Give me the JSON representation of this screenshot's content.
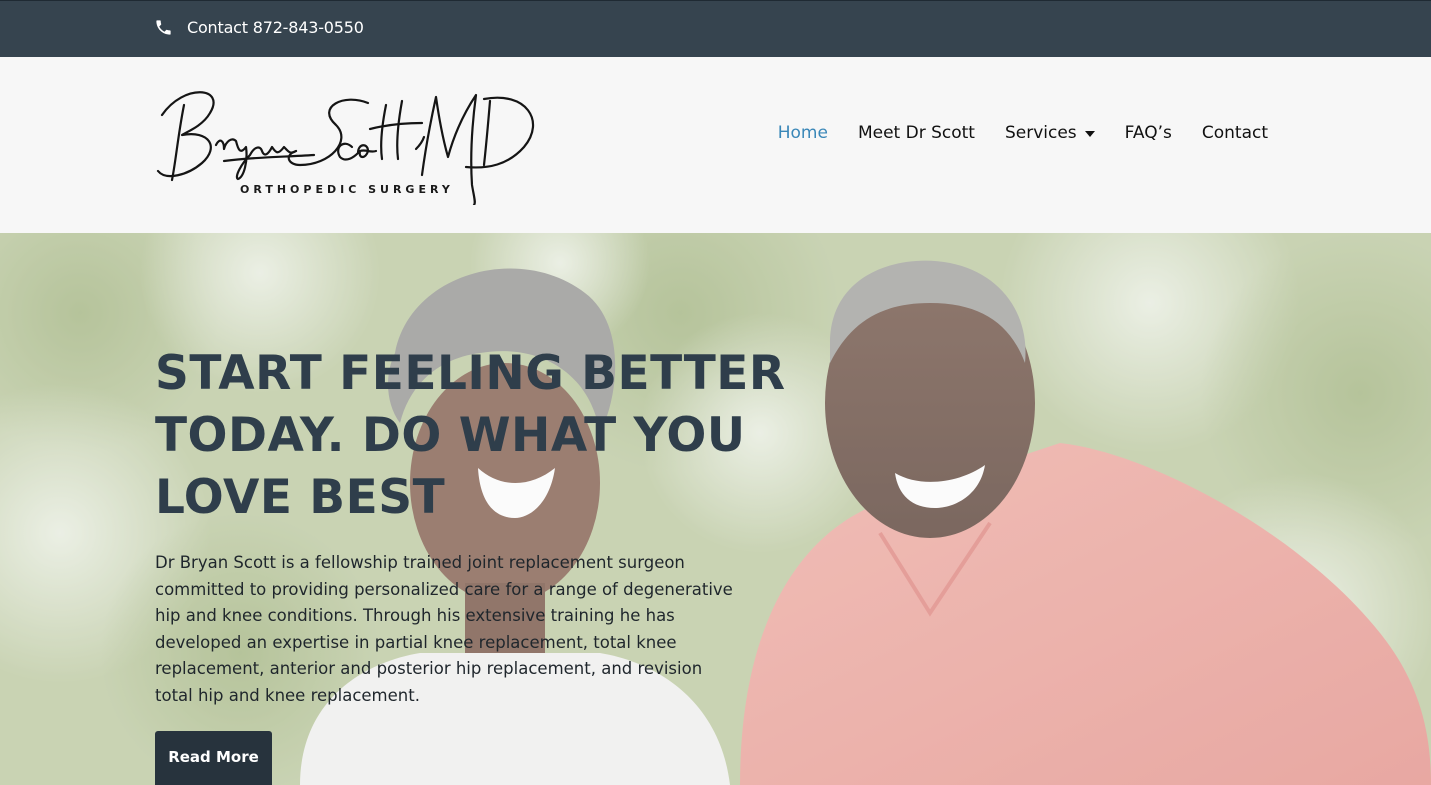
{
  "topbar": {
    "contact_text": "Contact 872-843-0550",
    "icon": "phone-icon",
    "background": "#36444f"
  },
  "header": {
    "logo": {
      "script_text": "Bryan Scott, MD",
      "subtitle": "ORTHOPEDIC SURGERY"
    },
    "nav": [
      {
        "label": "Home",
        "active": true
      },
      {
        "label": "Meet Dr Scott",
        "active": false
      },
      {
        "label": "Services",
        "active": false,
        "has_dropdown": true
      },
      {
        "label": "FAQ’s",
        "active": false
      },
      {
        "label": "Contact",
        "active": false
      }
    ],
    "active_color": "#3a87b8"
  },
  "hero": {
    "title": "START FEELING BETTER TODAY. DO WHAT YOU LOVE BEST",
    "body": "Dr Bryan Scott is a fellowship trained joint replacement surgeon committed to providing personalized care for a range of degenerative hip and knee conditions. Through his extensive training he has developed an expertise in partial knee replacement, total knee replacement, anterior and posterior hip replacement, and revision total hip and knee replacement.",
    "button_label": "Read More",
    "title_color": "#2f3e4b",
    "button_color": "#27333d"
  }
}
